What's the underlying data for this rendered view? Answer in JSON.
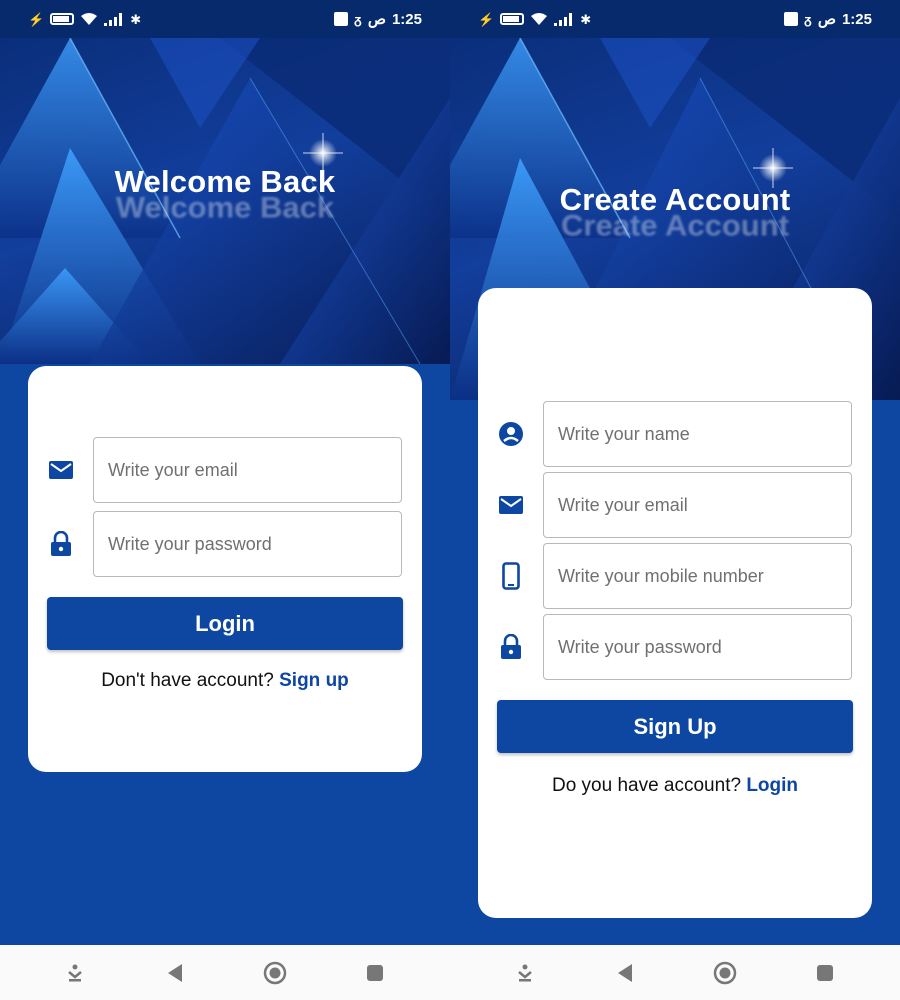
{
  "status_bar": {
    "time": "1:25",
    "arabic_indicator": "ص"
  },
  "login_screen": {
    "title": "Welcome Back",
    "email_placeholder": "Write your email",
    "password_placeholder": "Write your password",
    "login_button": "Login",
    "switch_prompt": "Don't have account?",
    "switch_link": "Sign up"
  },
  "signup_screen": {
    "title": "Create Account",
    "name_placeholder": "Write your name",
    "email_placeholder": "Write your email",
    "mobile_placeholder": "Write your mobile number",
    "password_placeholder": "Write your password",
    "signup_button": "Sign Up",
    "switch_prompt": "Do you have account?",
    "switch_link": "Login"
  },
  "icons": {
    "email": "mail-icon",
    "password": "lock-icon",
    "name": "account-circle-icon",
    "mobile": "phone-icon"
  },
  "colors": {
    "primary": "#0d47a1",
    "status_bar": "#062a6b",
    "card": "#ffffff",
    "input_border": "#b9b9b9"
  }
}
